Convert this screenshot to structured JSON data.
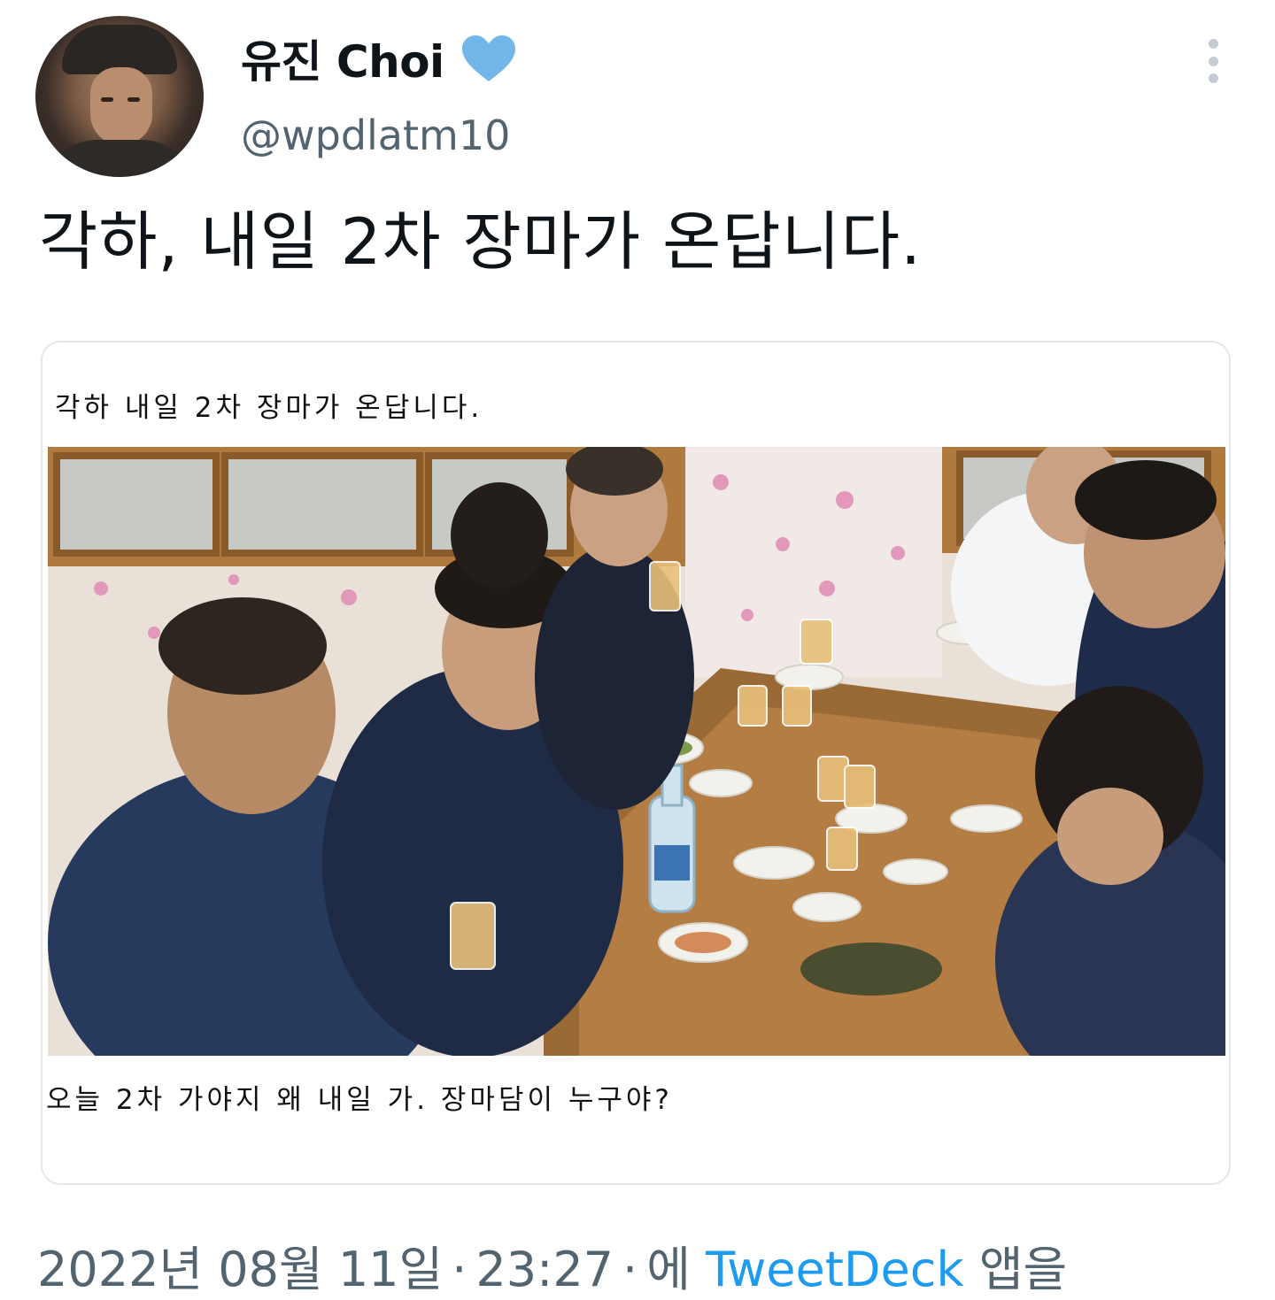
{
  "tweet": {
    "author": {
      "display_name": "유진 Choi",
      "handle": "@wpdlatm10",
      "verified_icon": "heart-icon",
      "verified_color": "#71b7ea"
    },
    "text": "각하, 내일 2차 장마가 온답니다.",
    "media": {
      "top_caption": "각하 내일 2차 장마가 온답니다.",
      "bottom_caption": "오늘 2차 가야지 왜 내일 가. 장마담이 누구야?"
    },
    "meta": {
      "date": "2022년 08월 11일",
      "time": "23:27",
      "via_prefix": "에",
      "source": "TweetDeck",
      "via_suffix": "앱을"
    },
    "colors": {
      "text": "#0f1419",
      "secondary": "#536471",
      "link": "#1d9bf0"
    }
  }
}
